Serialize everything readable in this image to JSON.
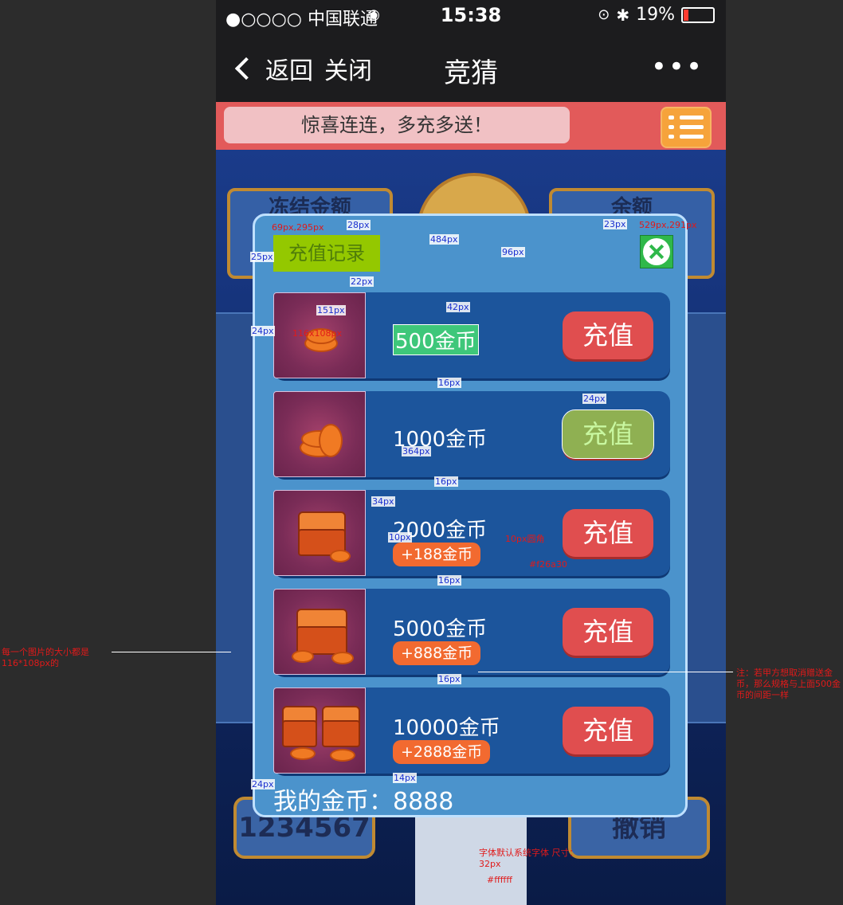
{
  "status_bar": {
    "carrier": "●○○○○ 中国联通",
    "wifi_icon": "wifi-icon",
    "time": "15:38",
    "battery": "19%",
    "battery_level": 0.19
  },
  "nav": {
    "back": "返回",
    "close": "关闭",
    "title": "竞猜",
    "more": "•••"
  },
  "banner": {
    "text": "惊喜连连，多充多送！",
    "menu_icon": "list-menu-icon"
  },
  "background": {
    "frozen": "冻结金额",
    "balance_box": "余额",
    "left_num": "1234567",
    "cancel": "撤销"
  },
  "modal": {
    "record_button": "充值记录",
    "close_icon": "close-icon",
    "items": [
      {
        "amount": "500金币",
        "bonus": "",
        "button": "充值"
      },
      {
        "amount": "1000金币",
        "bonus": "",
        "button": "充值"
      },
      {
        "amount": "2000金币",
        "bonus": "+188金币",
        "button": "充值"
      },
      {
        "amount": "5000金币",
        "bonus": "+888金币",
        "button": "充值"
      },
      {
        "amount": "10000金币",
        "bonus": "+2888金币",
        "button": "充值"
      }
    ],
    "balance_label": "我的金币：",
    "balance_value": "8888"
  },
  "annotations": {
    "pos1": "69px,295px",
    "pos2": "529px,291px",
    "d28": "28px",
    "d484": "484px",
    "d96": "96px",
    "d23": "23px",
    "d25": "25px",
    "d22": "22px",
    "d151": "151px",
    "d42": "42px",
    "d24a": "24px",
    "size": "116x108px",
    "d16a": "16px",
    "d24b": "24px",
    "d364": "364px",
    "d16b": "16px",
    "d34": "34px",
    "d10": "10px",
    "radius": "10px圆角",
    "color_bonus": "#f26a30",
    "d16c": "16px",
    "d16d": "16px",
    "d14": "14px",
    "d24c": "24px",
    "font_note": "字体默认系统字体 尺寸：32px",
    "color_white": "#ffffff",
    "img_note": "每一个图片的大小都是116*108px的",
    "right_note": "注：若甲方想取消赠送金币，那么规格与上面500金币的间距一样"
  }
}
